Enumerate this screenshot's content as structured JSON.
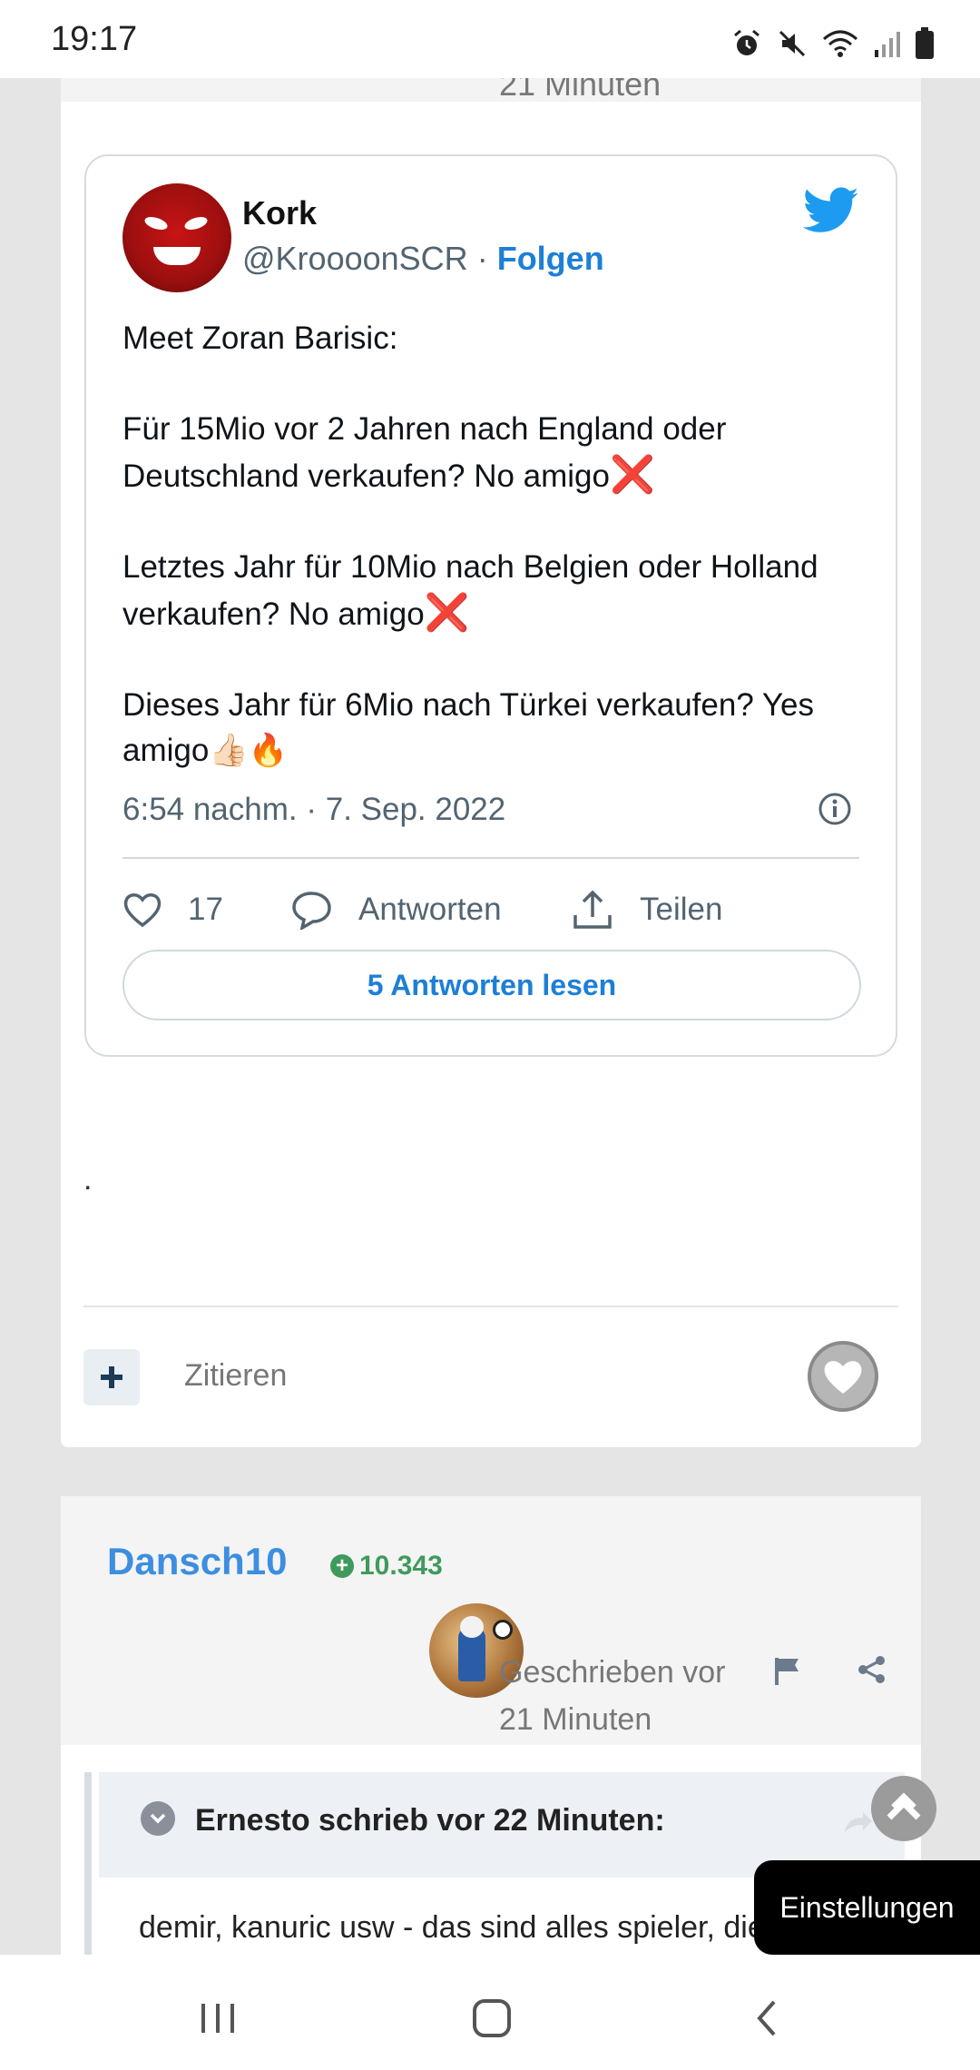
{
  "status_bar": {
    "time": "19:17",
    "icons": [
      "alarm-icon",
      "mute-icon",
      "wifi-icon",
      "signal-icon",
      "battery-icon"
    ]
  },
  "previous_post": {
    "timestamp_fragment": "21 Minuten"
  },
  "tweet": {
    "author_name": "Kork",
    "handle": "@KroooonSCR",
    "separator": "·",
    "follow_label": "Folgen",
    "lines": [
      "Meet Zoran Barisic:",
      "",
      "Für 15Mio vor 2 Jahren nach England oder Deutschland verkaufen? No amigo",
      "",
      "Letztes Jahr für 10Mio nach Belgien oder Holland verkaufen? No amigo",
      "",
      "Dieses Jahr für 6Mio nach Türkei verkaufen? Yes amigo"
    ],
    "emoji": {
      "cross": "❌",
      "thumbs": "👍🏻",
      "fire": "🔥"
    },
    "date": "6:54 nachm. · 7. Sep. 2022",
    "likes": "17",
    "reply_label": "Antworten",
    "share_label": "Teilen",
    "read_replies_label": "5 Antworten lesen",
    "accent_color": "#1d7fd6"
  },
  "post_footer": {
    "dot": ".",
    "quote_label": "Zitieren"
  },
  "post2": {
    "username": "Dansch10",
    "reputation": "10.343",
    "written_label": "Geschrieben vor",
    "written_time": "21 Minuten",
    "quote_title": "Ernesto schrieb vor 22 Minuten:",
    "quote_text": "demir, kanuric usw - das sind alles spieler, die"
  },
  "settings_label": "Einstellungen"
}
